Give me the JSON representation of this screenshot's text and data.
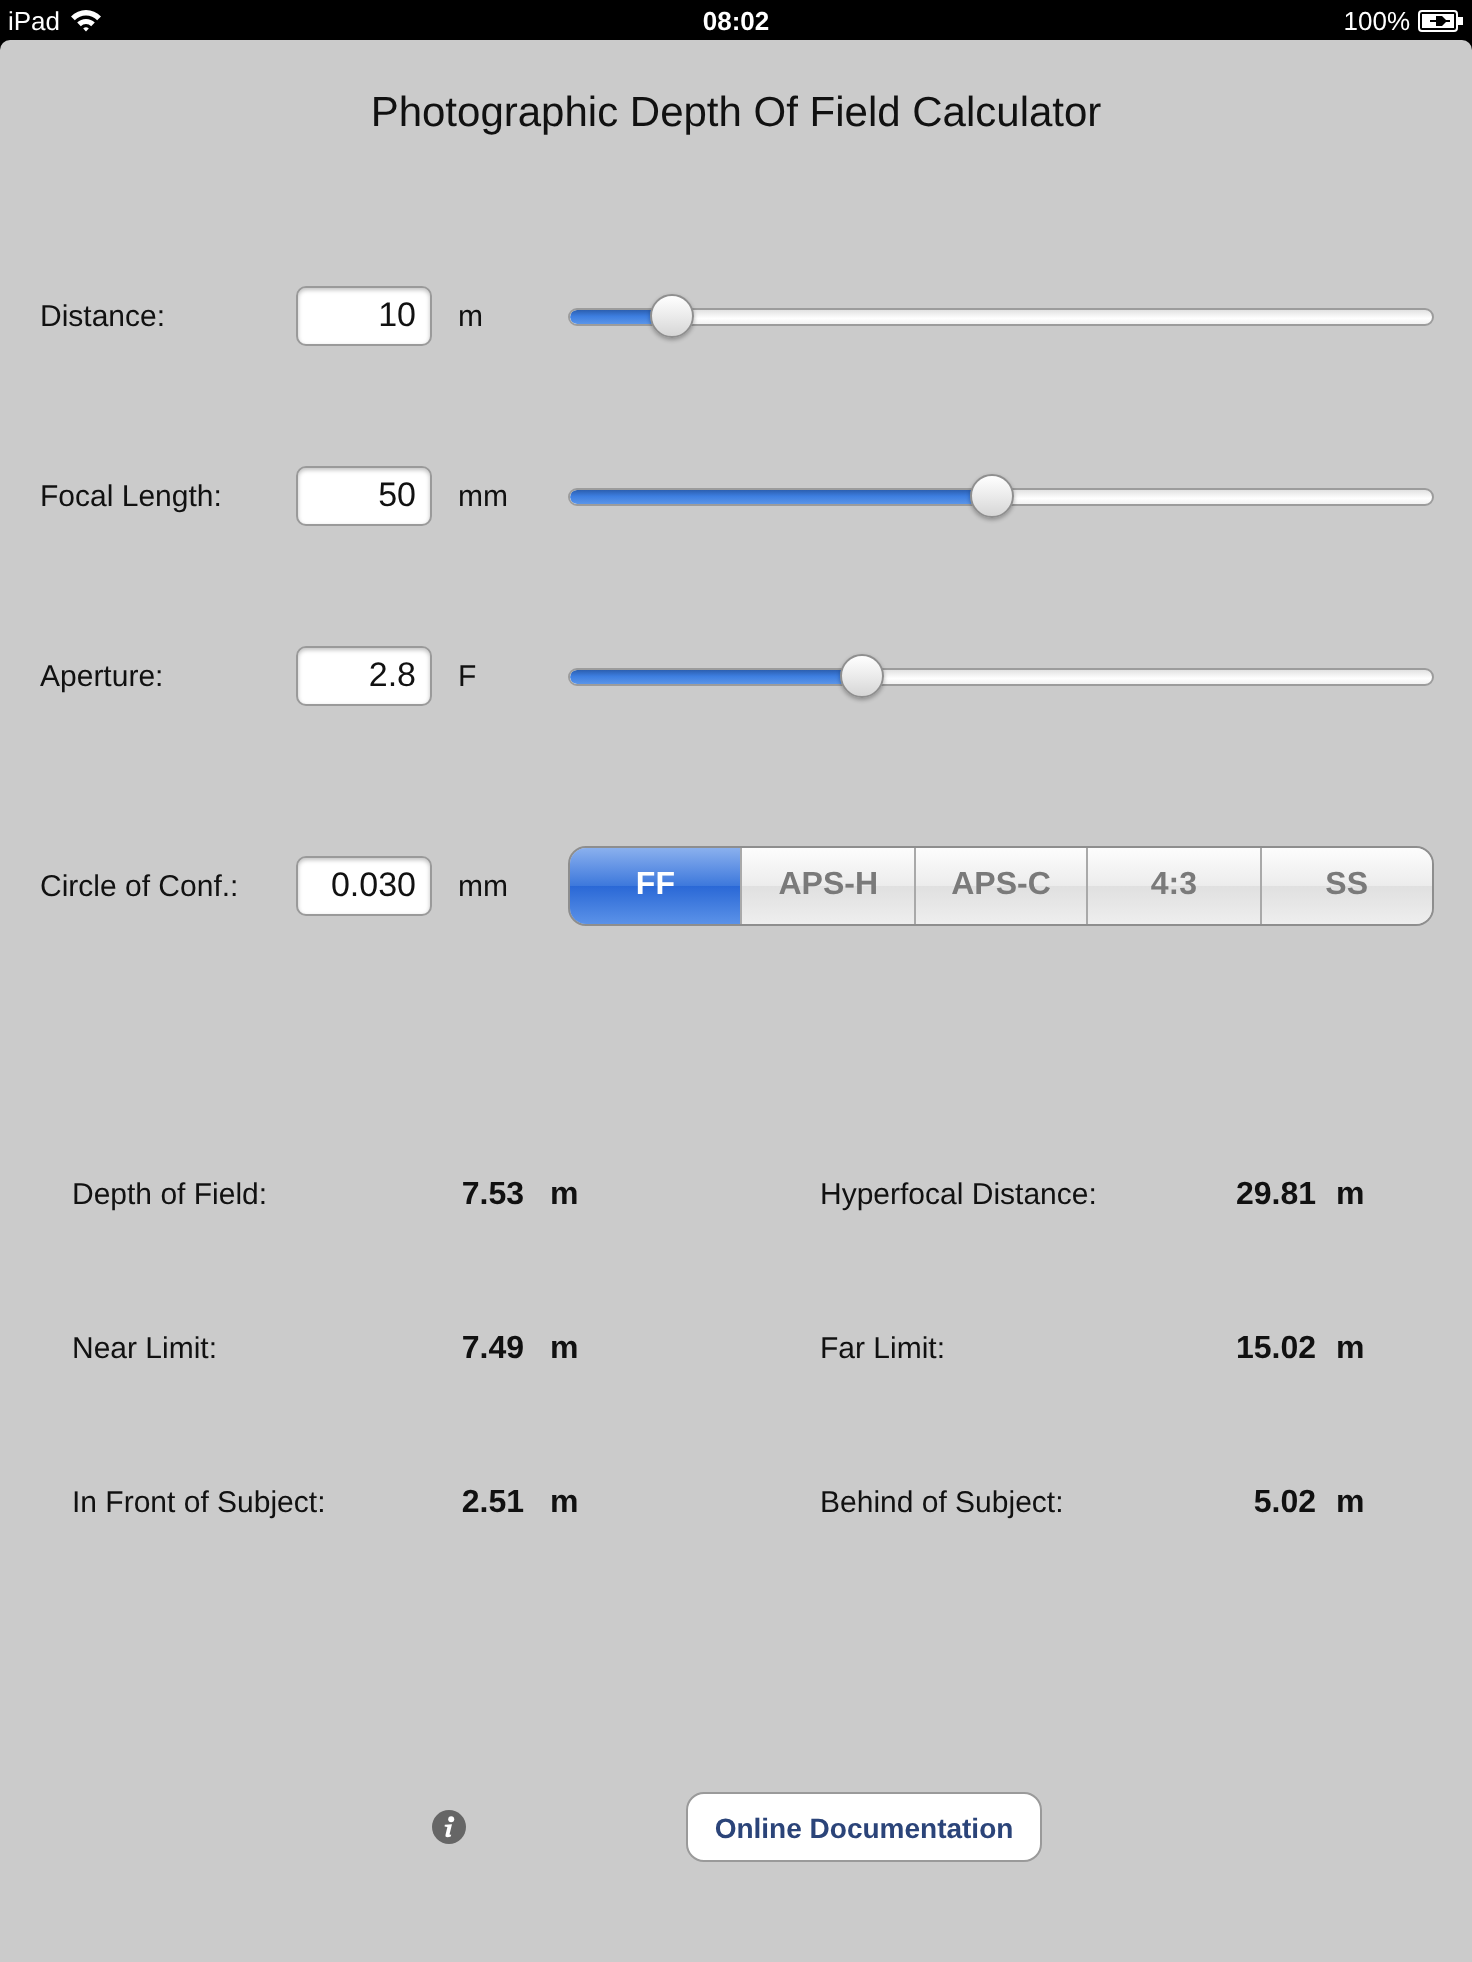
{
  "status_bar": {
    "device": "iPad",
    "time": "08:02",
    "battery": "100%"
  },
  "title": "Photographic Depth Of Field Calculator",
  "inputs": [
    {
      "label": "Distance:",
      "value": "10",
      "unit": "m",
      "kind": "slider",
      "level": 0.1
    },
    {
      "label": "Focal Length:",
      "value": "50",
      "unit": "mm",
      "kind": "slider",
      "level": 0.49
    },
    {
      "label": "Aperture:",
      "value": "2.8",
      "unit": "F",
      "kind": "slider",
      "level": 0.33
    },
    {
      "label": "Circle of Conf.:",
      "value": "0.030",
      "unit": "mm",
      "kind": "segmented",
      "segments": [
        {
          "label": "FF",
          "selected": true
        },
        {
          "label": "APS-H",
          "selected": false
        },
        {
          "label": "APS-C",
          "selected": false
        },
        {
          "label": "4:3",
          "selected": false
        },
        {
          "label": "SS",
          "selected": false
        }
      ]
    }
  ],
  "results": [
    {
      "label": "Depth of Field:",
      "value": "7.53",
      "unit": "m"
    },
    {
      "label": "Hyperfocal Distance:",
      "value": "29.81",
      "unit": "m"
    },
    {
      "label": "Near Limit:",
      "value": "7.49",
      "unit": "m"
    },
    {
      "label": "Far Limit:",
      "value": "15.02",
      "unit": "m"
    },
    {
      "label": "In Front of Subject:",
      "value": "2.51",
      "unit": "m"
    },
    {
      "label": "Behind of Subject:",
      "value": "5.02",
      "unit": "m"
    }
  ],
  "footer": {
    "button": "Online Documentation"
  }
}
